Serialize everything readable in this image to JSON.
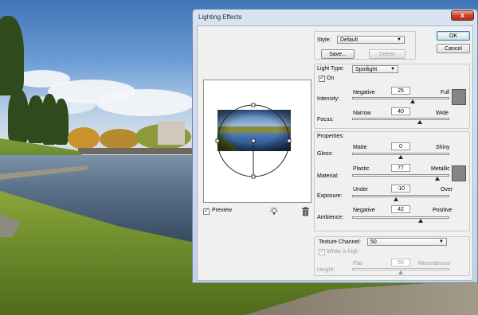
{
  "window": {
    "title": "Lighting Effects",
    "close_glyph": "x"
  },
  "style": {
    "label": "Style:",
    "value": "Default",
    "save_label": "Save...",
    "delete_label": "Delete"
  },
  "buttons": {
    "ok": "OK",
    "cancel": "Cancel"
  },
  "light_type": {
    "label": "Light Type:",
    "value": "Spotlight",
    "on_label": "On",
    "on_checked": true
  },
  "intensity": {
    "label": "Intensity:",
    "min_label": "Negative",
    "max_label": "Full",
    "value": "25",
    "swatch_color": "#858585"
  },
  "focus": {
    "label": "Focus:",
    "min_label": "Narrow",
    "max_label": "Wide",
    "value": "40"
  },
  "properties": {
    "label": "Properties:"
  },
  "gloss": {
    "label": "Gloss:",
    "min_label": "Matte",
    "max_label": "Shiny",
    "value": "0"
  },
  "material": {
    "label": "Material:",
    "min_label": "Plastic",
    "max_label": "Metallic",
    "value": "77",
    "swatch_color": "#858585"
  },
  "exposure": {
    "label": "Exposure:",
    "min_label": "Under",
    "max_label": "Over",
    "value": "-10"
  },
  "ambience": {
    "label": "Ambience:",
    "min_label": "Negative",
    "max_label": "Positive",
    "value": "42"
  },
  "texture": {
    "label": "Texture Channel:",
    "value": "50",
    "white_is_high_label": "White is high",
    "white_is_high_checked": true,
    "height_label": "Height:",
    "min_label": "Flat",
    "max_label": "Mountainous"
  },
  "preview": {
    "label": "Preview",
    "checked": true
  },
  "icons": {
    "light": "light-bulb-icon",
    "delete": "trash-icon"
  },
  "colors": {
    "title_bar": "#c3d3e6",
    "close_button": "#c8412c",
    "ok_border": "#3c7fb1"
  }
}
